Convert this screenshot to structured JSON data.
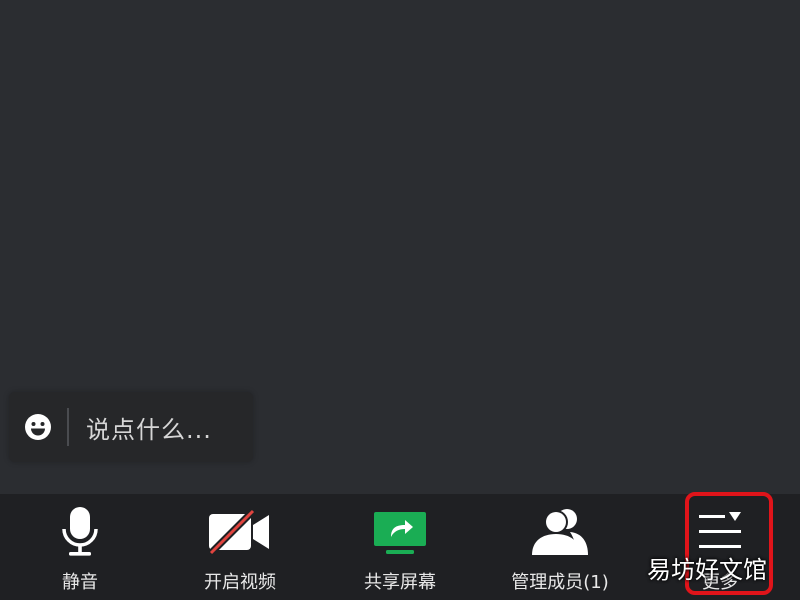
{
  "chat": {
    "placeholder": "说点什么...",
    "emoji_icon": "smiley-icon"
  },
  "toolbar": {
    "items": [
      {
        "label": "静音",
        "icon": "microphone-icon"
      },
      {
        "label": "开启视频",
        "icon": "camera-off-icon"
      },
      {
        "label": "共享屏幕",
        "icon": "share-screen-icon"
      },
      {
        "label": "管理成员(1)",
        "icon": "members-icon"
      },
      {
        "label": "更多",
        "icon": "more-menu-icon"
      }
    ]
  },
  "watermark": {
    "text": "易坊好文馆"
  },
  "colors": {
    "background": "#2b2d31",
    "toolbar": "#1f2023",
    "share_green": "#1aad54",
    "camera_off_red": "#e0443f",
    "highlight_red": "#e0141a"
  }
}
